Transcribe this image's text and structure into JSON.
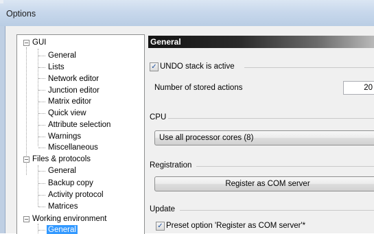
{
  "window": {
    "title": "Options"
  },
  "tree": {
    "nodes": [
      {
        "label": "GUI",
        "expander": "−"
      },
      {
        "label": "General"
      },
      {
        "label": "Lists"
      },
      {
        "label": "Network editor"
      },
      {
        "label": "Junction editor"
      },
      {
        "label": "Matrix editor"
      },
      {
        "label": "Quick view"
      },
      {
        "label": "Attribute selection"
      },
      {
        "label": "Warnings"
      },
      {
        "label": "Miscellaneous"
      },
      {
        "label": "Files & protocols",
        "expander": "−"
      },
      {
        "label": "General"
      },
      {
        "label": "Backup copy"
      },
      {
        "label": "Activity protocol"
      },
      {
        "label": "Matrices"
      },
      {
        "label": "Working environment",
        "expander": "−"
      },
      {
        "label": "General",
        "selected": true
      }
    ]
  },
  "panel": {
    "header": "General",
    "undo": {
      "label": "UNDO stack is active",
      "checked": true,
      "check_glyph": "✓"
    },
    "stored_actions": {
      "label": "Number of stored actions",
      "value": "20"
    },
    "cpu": {
      "group_label": "CPU",
      "selection": "Use all processor cores (8)"
    },
    "registration": {
      "group_label": "Registration",
      "button": "Register as COM server"
    },
    "update": {
      "group_label": "Update",
      "preset_label": "Preset option 'Register as COM server'*",
      "checked": true,
      "check_glyph": "✓"
    }
  },
  "icons": {
    "expander_minus": "minus-icon",
    "checkmark": "checkmark-icon"
  }
}
